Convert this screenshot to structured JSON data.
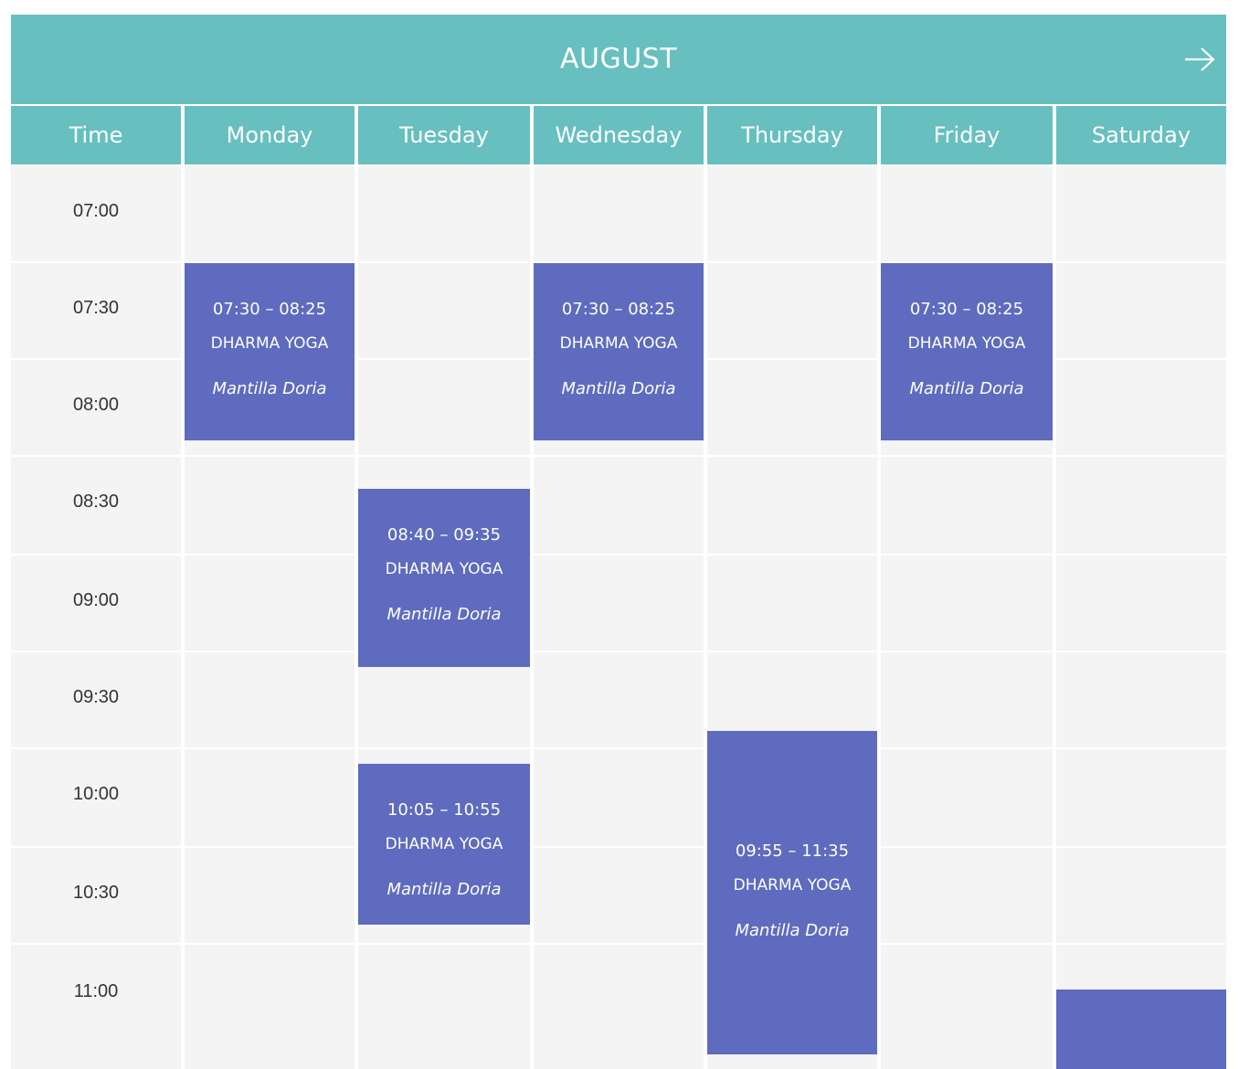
{
  "calendar": {
    "month": "AUGUST",
    "next_icon": "arrow-right-icon",
    "columns": [
      "Time",
      "Monday",
      "Tuesday",
      "Wednesday",
      "Thursday",
      "Friday",
      "Saturday"
    ],
    "time_slots": [
      "07:00",
      "07:30",
      "08:00",
      "08:30",
      "09:00",
      "09:30",
      "10:00",
      "10:30",
      "11:00"
    ],
    "colors": {
      "header": "#68bfbf",
      "event": "#5e6bbf",
      "cell": "#f4f4f4"
    },
    "events": [
      {
        "day": "Monday",
        "start": "07:30",
        "end": "08:25",
        "time": "07:30 – 08:25",
        "title": "DHARMA YOGA",
        "teacher": "Mantilla Doria"
      },
      {
        "day": "Wednesday",
        "start": "07:30",
        "end": "08:25",
        "time": "07:30 – 08:25",
        "title": "DHARMA YOGA",
        "teacher": "Mantilla Doria"
      },
      {
        "day": "Friday",
        "start": "07:30",
        "end": "08:25",
        "time": "07:30 – 08:25",
        "title": "DHARMA YOGA",
        "teacher": "Mantilla Doria"
      },
      {
        "day": "Tuesday",
        "start": "08:40",
        "end": "09:35",
        "time": "08:40 – 09:35",
        "title": "DHARMA YOGA",
        "teacher": "Mantilla Doria"
      },
      {
        "day": "Tuesday",
        "start": "10:05",
        "end": "10:55",
        "time": "10:05 – 10:55",
        "title": "DHARMA YOGA",
        "teacher": "Mantilla Doria"
      },
      {
        "day": "Thursday",
        "start": "09:55",
        "end": "11:35",
        "time": "09:55 – 11:35",
        "title": "DHARMA YOGA",
        "teacher": "Mantilla Doria"
      },
      {
        "day": "Saturday",
        "start": "11:15",
        "end": "",
        "time": "",
        "title": "",
        "teacher": ""
      }
    ]
  }
}
